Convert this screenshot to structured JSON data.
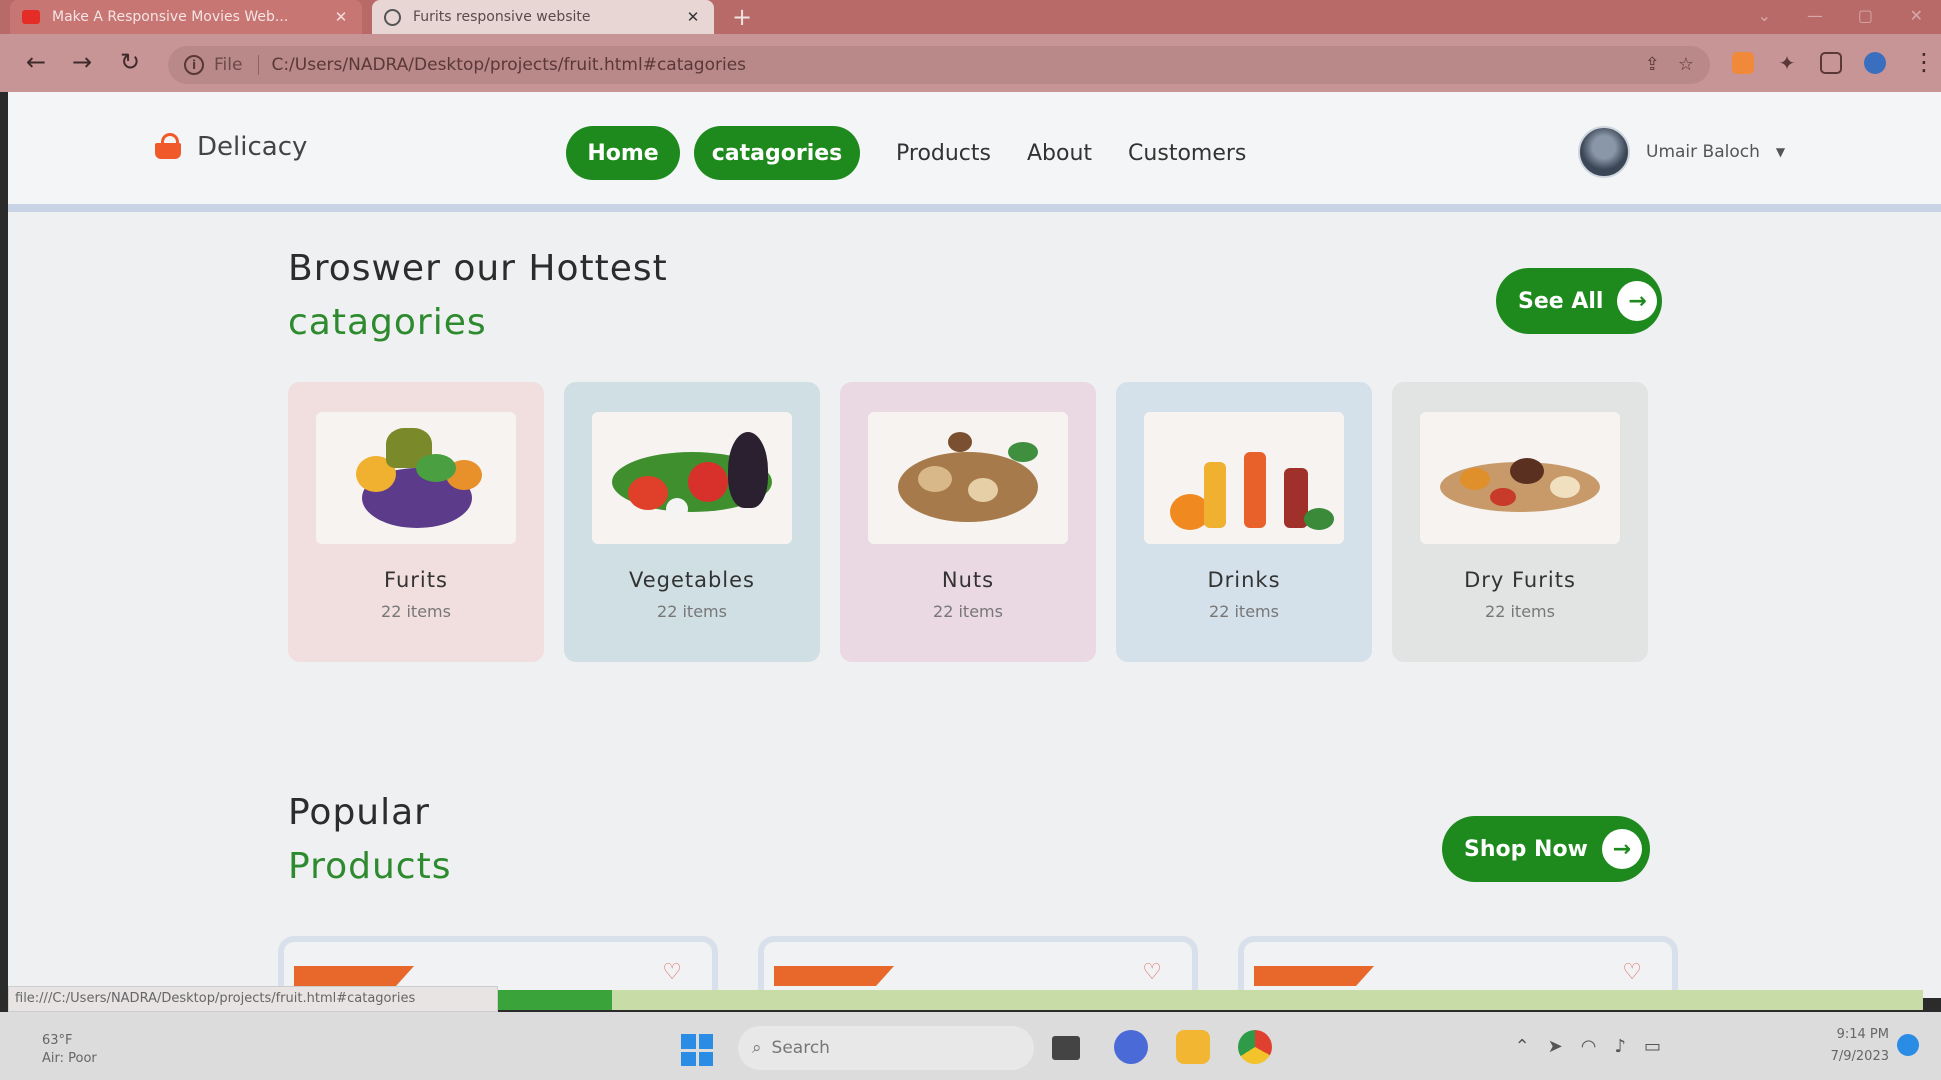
{
  "browser": {
    "tabs": [
      {
        "title": "Make A Responsive Movies Web..."
      },
      {
        "title": "Furits responsive website"
      }
    ],
    "url_label": "File",
    "url": "C:/Users/NADRA/Desktop/projects/fruit.html#catagories",
    "status_url": "file:///C:/Users/NADRA/Desktop/projects/fruit.html#catagories",
    "load_progress": 0.08
  },
  "site": {
    "logo_text": "Delicacy",
    "nav": {
      "home": "Home",
      "categories": "catagories",
      "products": "Products",
      "about": "About",
      "customers": "Customers"
    },
    "user_name": "Umair Baloch"
  },
  "categories_section": {
    "title": "Broswer our Hottest",
    "subtitle": "catagories",
    "see_all": "See All",
    "items": [
      {
        "name": "Furits",
        "count": "22 items",
        "bg": "#f1dede"
      },
      {
        "name": "Vegetables",
        "count": "22 items",
        "bg": "#cfdfe4"
      },
      {
        "name": "Nuts",
        "count": "22 items",
        "bg": "#ead8e2"
      },
      {
        "name": "Drinks",
        "count": "22 items",
        "bg": "#d4e0ea"
      },
      {
        "name": "Dry Furits",
        "count": "22 items",
        "bg": "#e2e4e4"
      }
    ]
  },
  "popular_section": {
    "title": "Popular",
    "subtitle": "Products",
    "shop_now": "Shop Now"
  },
  "taskbar": {
    "weather_temp": "63°F",
    "weather_desc": "Air: Poor",
    "search_placeholder": "Search",
    "time": "9:14 PM",
    "date": "7/9/2023"
  },
  "colors": {
    "brand_green": "#1e8a1e",
    "accent_orange": "#f05a2a"
  }
}
